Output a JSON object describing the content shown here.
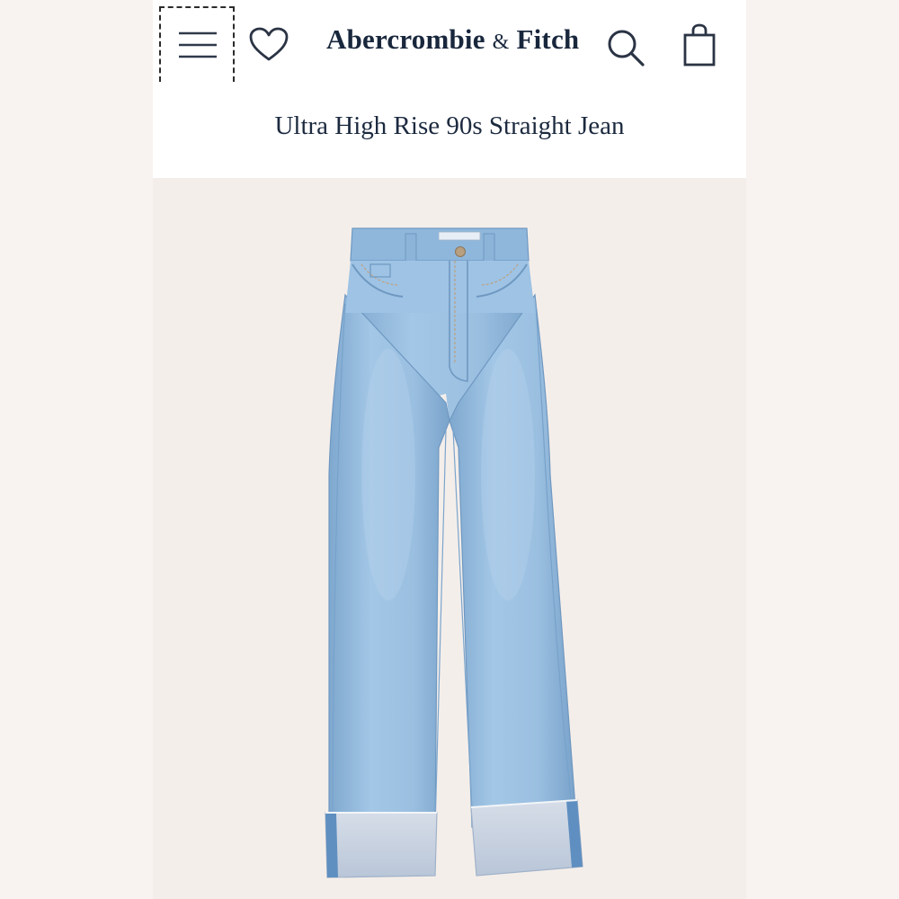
{
  "header": {
    "brand_name": "Abercrombie",
    "brand_ampersand": "&",
    "brand_suffix": "Fitch",
    "menu_icon": "hamburger-menu-icon",
    "wishlist_icon": "heart-icon",
    "search_icon": "search-icon",
    "bag_icon": "shopping-bag-icon"
  },
  "product": {
    "title": "Ultra High Rise 90s Straight Jean",
    "image_subject": "light-wash straight-leg jeans with cuffed hems"
  },
  "colors": {
    "brand_navy": "#19273d",
    "denim": "#9ec3e4",
    "background": "#f6f1ee"
  }
}
